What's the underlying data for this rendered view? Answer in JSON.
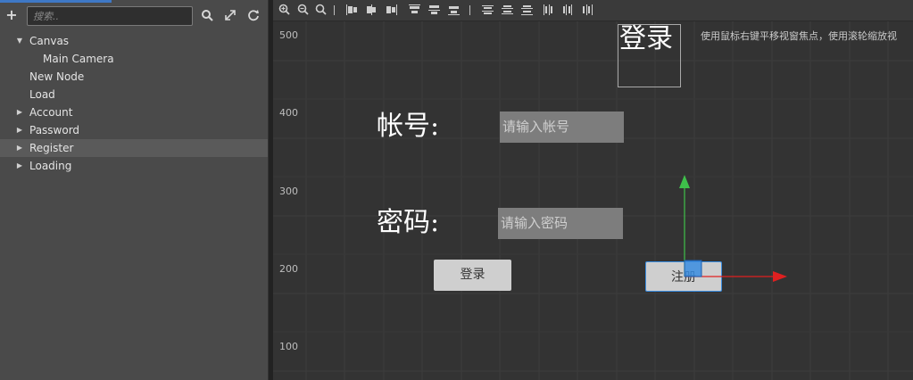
{
  "hierarchy": {
    "search_placeholder": "搜索..",
    "items": [
      {
        "label": "Canvas",
        "expanded": true
      },
      {
        "label": "Main Camera"
      },
      {
        "label": "New Node"
      },
      {
        "label": "Load"
      },
      {
        "label": "Account",
        "expanded": false
      },
      {
        "label": "Password",
        "expanded": false
      },
      {
        "label": "Register",
        "expanded": false,
        "selected": true
      },
      {
        "label": "Loading",
        "expanded": false
      }
    ]
  },
  "scene": {
    "hint": "使用鼠标右键平移视窗焦点，使用滚轮缩放视",
    "axis_labels": [
      "500",
      "400",
      "300",
      "200",
      "100"
    ],
    "nodes": {
      "title_text": "登录",
      "account_label": "帐号:",
      "account_placeholder": "请输入帐号",
      "password_label": "密码:",
      "password_placeholder": "请输入密码",
      "login_button": "登录",
      "register_button": "注册"
    }
  },
  "colors": {
    "panel_bg": "#4a4a4a",
    "scene_bg": "#333333",
    "selection": "#5a5a5a",
    "gizmo_x": "#e02020",
    "gizmo_y": "#3ec04a",
    "gizmo_select": "#3a8de0"
  }
}
